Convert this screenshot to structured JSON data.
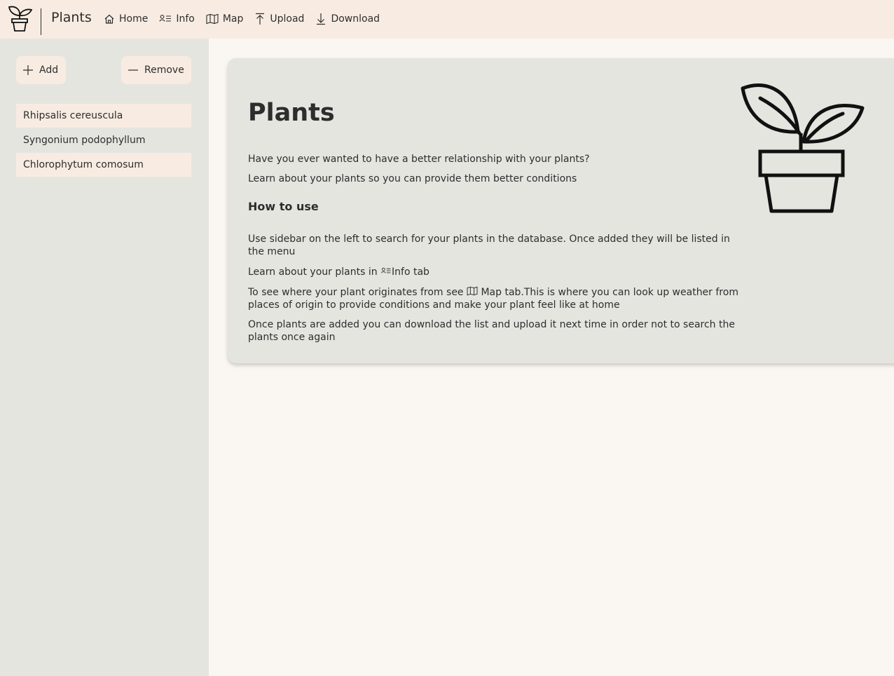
{
  "header": {
    "title": "Plants",
    "nav": {
      "home": "Home",
      "info": "Info",
      "map": "Map",
      "upload": "Upload",
      "download": "Download"
    }
  },
  "sidebar": {
    "add_label": "Add",
    "remove_label": "Remove",
    "plants": [
      "Rhipsalis cereuscula",
      "Syngonium podophyllum",
      "Chlorophytum comosum"
    ]
  },
  "main": {
    "title": "Plants",
    "intro1": "Have you ever wanted to have a better relationship with your plants?",
    "intro2": "Learn about your plants so you can provide them better conditions",
    "howto_heading": "How to use",
    "step1": "Use sidebar on the left to search for your plants in the database. Once added they will be listed in the menu",
    "step2_before": "Learn about your plants in",
    "step2_after": "Info tab",
    "step3_before": "To see where your plant originates from see",
    "step3_after": "Map tab.This is where you can look up weather from places of origin to provide conditions and make your plant feel like at home",
    "step4": "Once plants are added you can download the list and upload it next time in order not to search the plants once again"
  },
  "colors": {
    "header_bg": "#f8ece2",
    "sidebar_bg": "#e5e5e0",
    "page_bg": "#faf6f2",
    "text": "#2d2d2d"
  }
}
